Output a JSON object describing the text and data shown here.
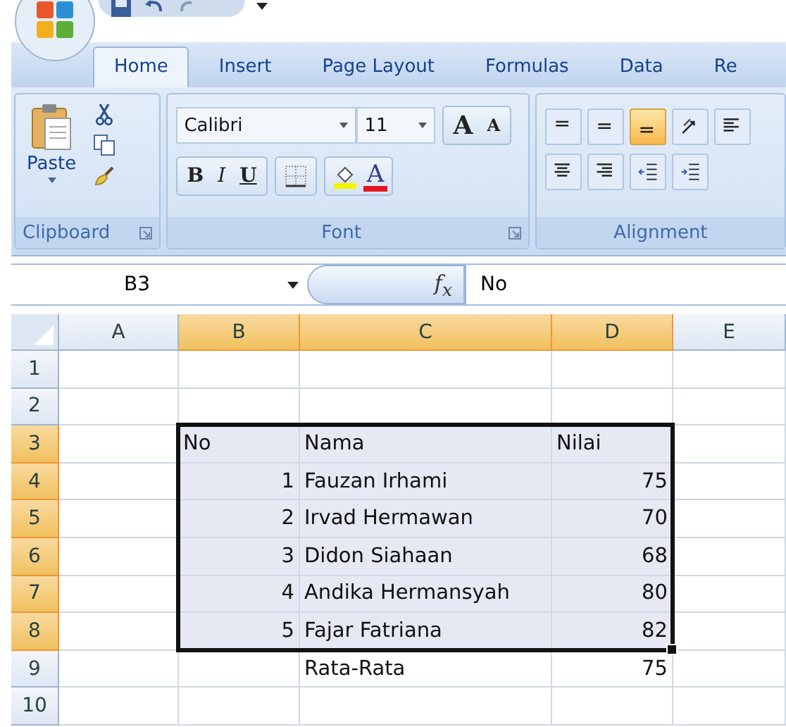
{
  "tabs": [
    {
      "label": "Home",
      "selected": true
    },
    {
      "label": "Insert",
      "selected": false
    },
    {
      "label": "Page Layout",
      "selected": false
    },
    {
      "label": "Formulas",
      "selected": false
    },
    {
      "label": "Data",
      "selected": false
    },
    {
      "label": "Re",
      "selected": false
    }
  ],
  "clipboard": {
    "label": "Clipboard",
    "paste": "Paste"
  },
  "font": {
    "label": "Font",
    "name": "Calibri",
    "size": "11",
    "grow": "A",
    "shrink": "A",
    "bold": "B",
    "italic": "I",
    "underline": "U",
    "color_letter": "A"
  },
  "alignment": {
    "label": "Alignment",
    "buttons": [
      {
        "kind": "top",
        "selected": false
      },
      {
        "kind": "middle",
        "selected": false
      },
      {
        "kind": "bottom",
        "selected": true
      },
      {
        "kind": "orient",
        "selected": false
      },
      {
        "kind": "left",
        "selected": false
      },
      {
        "kind": "center",
        "selected": false
      },
      {
        "kind": "right",
        "selected": false
      },
      {
        "kind": "outdent",
        "selected": false
      },
      {
        "kind": "indent",
        "selected": false
      }
    ]
  },
  "formula_bar": {
    "name_box": "B3",
    "fx": "f$_{x}$",
    "value": "No"
  },
  "columns": [
    {
      "label": "A",
      "selected": false
    },
    {
      "label": "B",
      "selected": true
    },
    {
      "label": "C",
      "selected": true
    },
    {
      "label": "D",
      "selected": true
    },
    {
      "label": "E",
      "selected": false
    }
  ],
  "rows": [
    {
      "label": "1",
      "selected": false,
      "cells": [
        null,
        null,
        null,
        null,
        null
      ]
    },
    {
      "label": "2",
      "selected": false,
      "cells": [
        null,
        null,
        null,
        null,
        null
      ]
    },
    {
      "label": "3",
      "selected": true,
      "cells": [
        null,
        {
          "text": "No",
          "kind": "text"
        },
        {
          "text": "Nama",
          "kind": "text"
        },
        {
          "text": "Nilai",
          "kind": "text"
        },
        null
      ]
    },
    {
      "label": "4",
      "selected": true,
      "cells": [
        null,
        {
          "text": "1",
          "kind": "number"
        },
        {
          "text": "Fauzan Irhami",
          "kind": "text"
        },
        {
          "text": "75",
          "kind": "number"
        },
        null
      ]
    },
    {
      "label": "5",
      "selected": true,
      "cells": [
        null,
        {
          "text": "2",
          "kind": "number"
        },
        {
          "text": "Irvad Hermawan",
          "kind": "text"
        },
        {
          "text": "70",
          "kind": "number"
        },
        null
      ]
    },
    {
      "label": "6",
      "selected": true,
      "cells": [
        null,
        {
          "text": "3",
          "kind": "number"
        },
        {
          "text": "Didon Siahaan",
          "kind": "text"
        },
        {
          "text": "68",
          "kind": "number"
        },
        null
      ]
    },
    {
      "label": "7",
      "selected": true,
      "cells": [
        null,
        {
          "text": "4",
          "kind": "number"
        },
        {
          "text": "Andika Hermansyah",
          "kind": "text"
        },
        {
          "text": "80",
          "kind": "number"
        },
        null
      ]
    },
    {
      "label": "8",
      "selected": true,
      "cells": [
        null,
        {
          "text": "5",
          "kind": "number"
        },
        {
          "text": "Fajar Fatriana",
          "kind": "text"
        },
        {
          "text": "82",
          "kind": "number"
        },
        null
      ]
    },
    {
      "label": "9",
      "selected": false,
      "cells": [
        null,
        null,
        {
          "text": "Rata-Rata",
          "kind": "text"
        },
        {
          "text": "75",
          "kind": "number"
        },
        null
      ]
    },
    {
      "label": "10",
      "selected": false,
      "cells": [
        null,
        null,
        null,
        null,
        null
      ]
    }
  ]
}
